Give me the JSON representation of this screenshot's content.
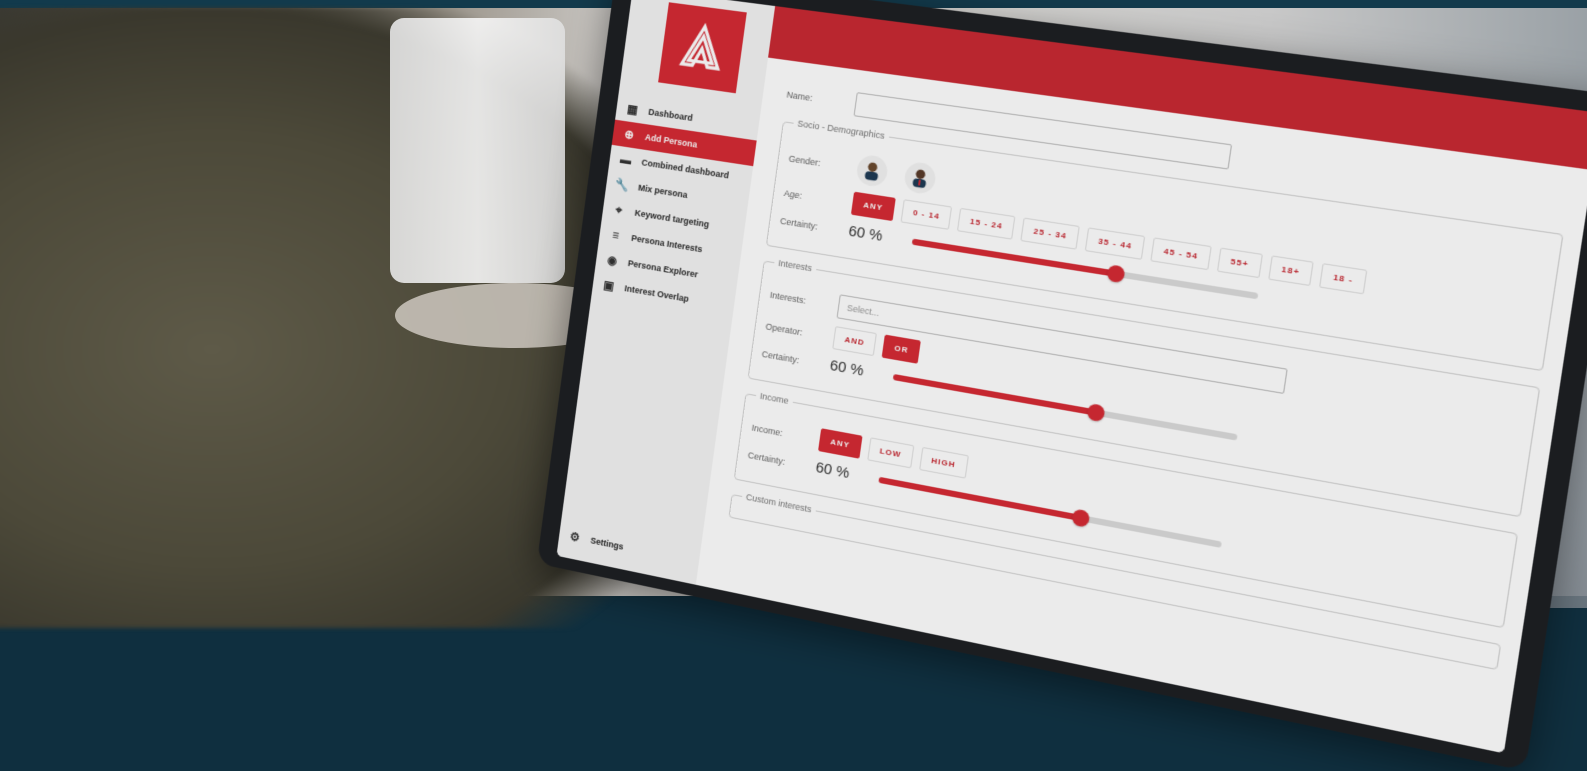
{
  "sidebar": {
    "items": [
      {
        "icon": "dashboard-icon",
        "label": "Dashboard",
        "active": false
      },
      {
        "icon": "add-persona-icon",
        "label": "Add Persona",
        "active": true
      },
      {
        "icon": "combined-dashboard-icon",
        "label": "Combined dashboard",
        "active": false
      },
      {
        "icon": "wrench-icon",
        "label": "Mix persona",
        "active": false
      },
      {
        "icon": "keyword-icon",
        "label": "Keyword targeting",
        "active": false
      },
      {
        "icon": "interests-icon",
        "label": "Persona Interests",
        "active": false
      },
      {
        "icon": "explorer-icon",
        "label": "Persona Explorer",
        "active": false
      },
      {
        "icon": "overlap-icon",
        "label": "Interest Overlap",
        "active": false
      }
    ],
    "settings_label": "Settings"
  },
  "form": {
    "name_label": "Name:",
    "socio_legend": "Socio - Demographics",
    "gender_label": "Gender:",
    "age_label": "Age:",
    "age_options": [
      "ANY",
      "0 - 14",
      "15 - 24",
      "25 - 34",
      "35 - 44",
      "45 - 54",
      "55+",
      "18+",
      "18 -"
    ],
    "age_selected": "ANY",
    "certainty_label": "Certainty:",
    "certainty_socio": "60 %",
    "certainty_socio_value": 60,
    "interests_legend": "Interests",
    "interests_label": "Interests:",
    "interests_placeholder": "Select...",
    "operator_label": "Operator:",
    "operator_options": [
      "AND",
      "OR"
    ],
    "operator_selected": "OR",
    "certainty_interests": "60 %",
    "certainty_interests_value": 60,
    "income_legend": "Income",
    "income_label": "Income:",
    "income_options": [
      "ANY",
      "LOW",
      "HIGH"
    ],
    "income_selected": "ANY",
    "certainty_income": "60 %",
    "certainty_income_value": 60,
    "custom_interests_legend": "Custom interests"
  },
  "colors": {
    "accent": "#d62b35",
    "header": "#c92a34",
    "sidebar_bg": "#f3f3f3"
  }
}
